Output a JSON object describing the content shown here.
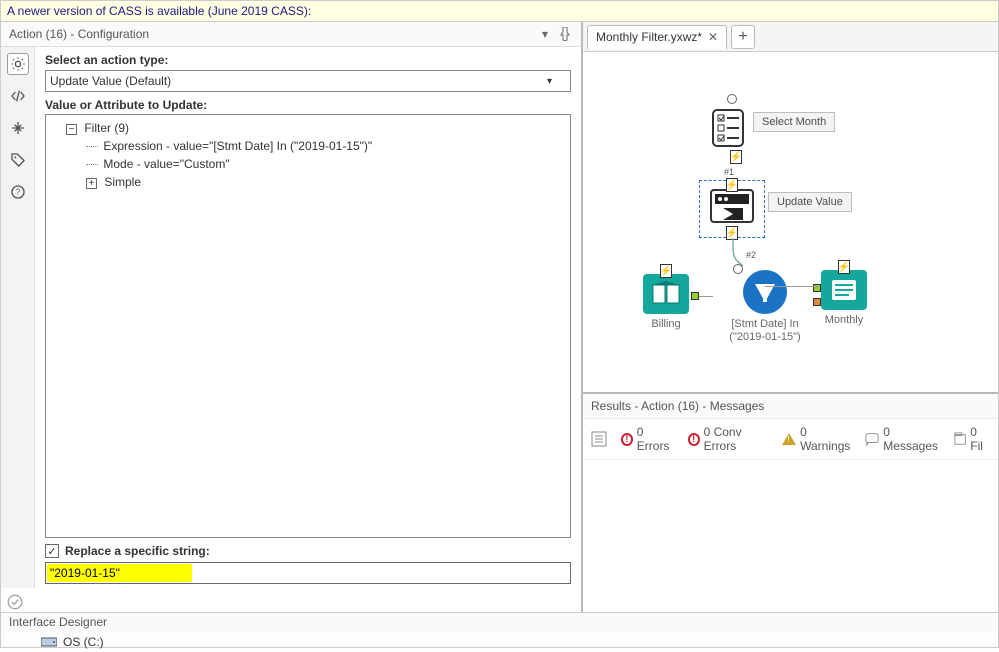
{
  "banner": "A newer version of CASS is available (June 2019 CASS):",
  "left": {
    "title": "Action (16) - Configuration",
    "select_label": "Select an action type:",
    "select_value": "Update Value (Default)",
    "tree_label": "Value or Attribute to Update:",
    "tree": {
      "root": "Filter (9)",
      "expr": "Expression - value=\"[Stmt Date] In (\"2019-01-15\")\"",
      "mode": "Mode - value=\"Custom\"",
      "simple": "Simple"
    },
    "replace_label": "Replace a specific string:",
    "replace_value": "\"2019-01-15\""
  },
  "tabs": {
    "active": "Monthly Filter.yxwz*"
  },
  "canvas": {
    "select_month": "Select Month",
    "update_value": "Update Value",
    "billing": "Billing",
    "filter_expr": "[Stmt Date] In (\"2019-01-15\")",
    "monthly": "Monthly",
    "hash1": "#1",
    "hash2": "#2"
  },
  "results": {
    "title": "Results - Action (16) - Messages",
    "errors": "0 Errors",
    "conv": "0 Conv Errors",
    "warnings": "0 Warnings",
    "messages": "0 Messages",
    "files": "0 Fil"
  },
  "footer": {
    "designer": "Interface Designer",
    "drive": "OS (C:)"
  },
  "colors": {
    "teal": "#14a89c",
    "blue": "#1b73c6",
    "selection": "#2a6fc9"
  }
}
